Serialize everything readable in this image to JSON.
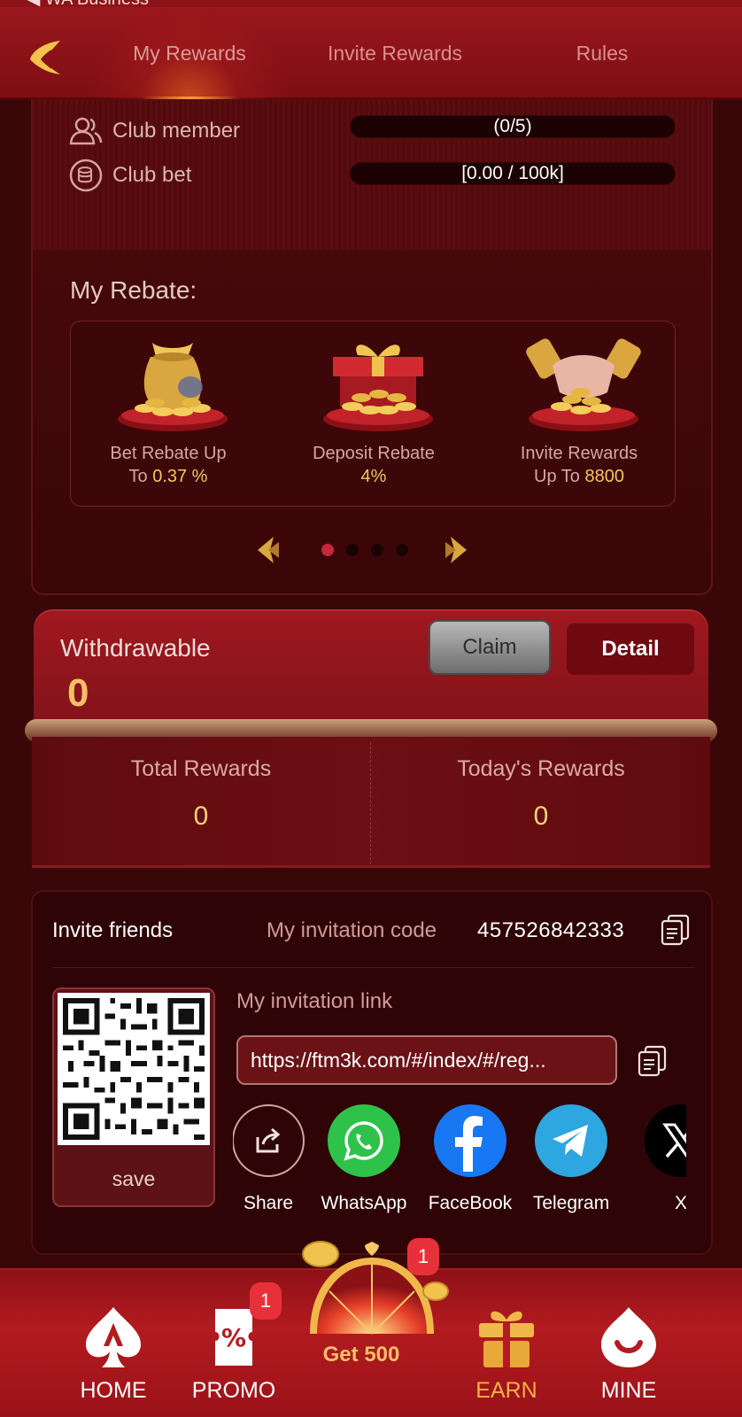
{
  "status_bar": {
    "text": "◀ WA Business"
  },
  "header": {
    "back_label": "back",
    "tabs": [
      {
        "label": "My Rewards",
        "active": true
      },
      {
        "label": "Invite Rewards",
        "active": false
      },
      {
        "label": "Rules",
        "active": false
      }
    ]
  },
  "club": {
    "member_label": "Club member",
    "member_value": "(0/5)",
    "member_progress": 0,
    "bet_label": "Club bet",
    "bet_value": "[0.00 / 100k]",
    "bet_progress": 0
  },
  "rebate": {
    "title": "My Rebate:",
    "items": [
      {
        "line1": "Bet Rebate Up",
        "line2_prefix": "To ",
        "line2_value": "0.37 %",
        "icon": "coin-bag-icon"
      },
      {
        "line1": "Deposit Rebate",
        "line2_prefix": "",
        "line2_value": "4%",
        "icon": "gift-box-icon"
      },
      {
        "line1": "Invite Rewards",
        "line2_prefix": "Up To ",
        "line2_value": "8800",
        "icon": "handshake-icon"
      }
    ],
    "pager": {
      "pages": 4,
      "current": 1
    }
  },
  "withdraw": {
    "label": "Withdrawable",
    "value": "0",
    "claim_label": "Claim",
    "detail_label": "Detail"
  },
  "rewards": {
    "total_label": "Total Rewards",
    "total_value": "0",
    "today_label": "Today's Rewards",
    "today_value": "0"
  },
  "invite": {
    "title": "Invite friends",
    "code_label": "My invitation code",
    "code": "457526842333",
    "link_label": "My invitation link",
    "link": "https://ftm3k.com/#/index/#/reg...",
    "save_label": "save",
    "share": [
      {
        "label": "Share",
        "icon": "share-icon",
        "color": "#2e0406"
      },
      {
        "label": "WhatsApp",
        "icon": "whatsapp-icon",
        "color": "#2fc24a"
      },
      {
        "label": "FaceBook",
        "icon": "facebook-icon",
        "color": "#1877f2"
      },
      {
        "label": "Telegram",
        "icon": "telegram-icon",
        "color": "#2ea6e0"
      },
      {
        "label": "X",
        "icon": "x-icon",
        "color": "#000000"
      }
    ]
  },
  "nav": {
    "items": [
      {
        "label": "HOME",
        "icon": "spade-icon",
        "active": false
      },
      {
        "label": "PROMO",
        "icon": "ticket-icon",
        "active": false,
        "badge": "1"
      },
      {
        "label": "EARN",
        "icon": "gift-icon",
        "active": true
      },
      {
        "label": "MINE",
        "icon": "drop-smile-icon",
        "active": false
      }
    ],
    "center": {
      "label": "Get 500",
      "badge": "1",
      "icon": "lucky-wheel-icon"
    }
  },
  "colors": {
    "brand_red": "#9b171c",
    "gold": "#f3c067",
    "accent_dot": "#c4283a"
  }
}
